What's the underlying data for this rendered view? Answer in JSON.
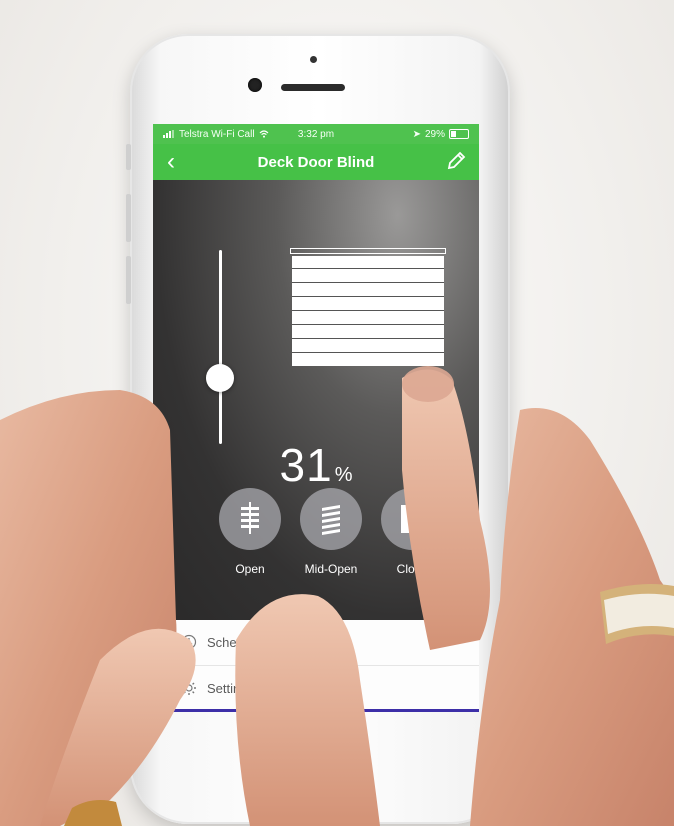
{
  "status_bar": {
    "carrier": "Telstra Wi-Fi Call",
    "time": "3:32 pm",
    "battery": "29%"
  },
  "header": {
    "title": "Deck Door Blind",
    "back_icon": "chevron-left-icon",
    "edit_icon": "pencil-icon",
    "accent_color": "#46c147"
  },
  "blind": {
    "position_value": "31",
    "position_unit": "%",
    "slider_level": 0.31
  },
  "presets": [
    {
      "label": "Open",
      "icon": "blind-open-icon"
    },
    {
      "label": "Mid-Open",
      "icon": "blind-mid-open-icon"
    },
    {
      "label": "Close",
      "icon": "blind-close-icon"
    }
  ],
  "menu": [
    {
      "label": "Sche",
      "icon": "clock-icon"
    },
    {
      "label": "Settings",
      "icon": "gear-icon"
    }
  ]
}
